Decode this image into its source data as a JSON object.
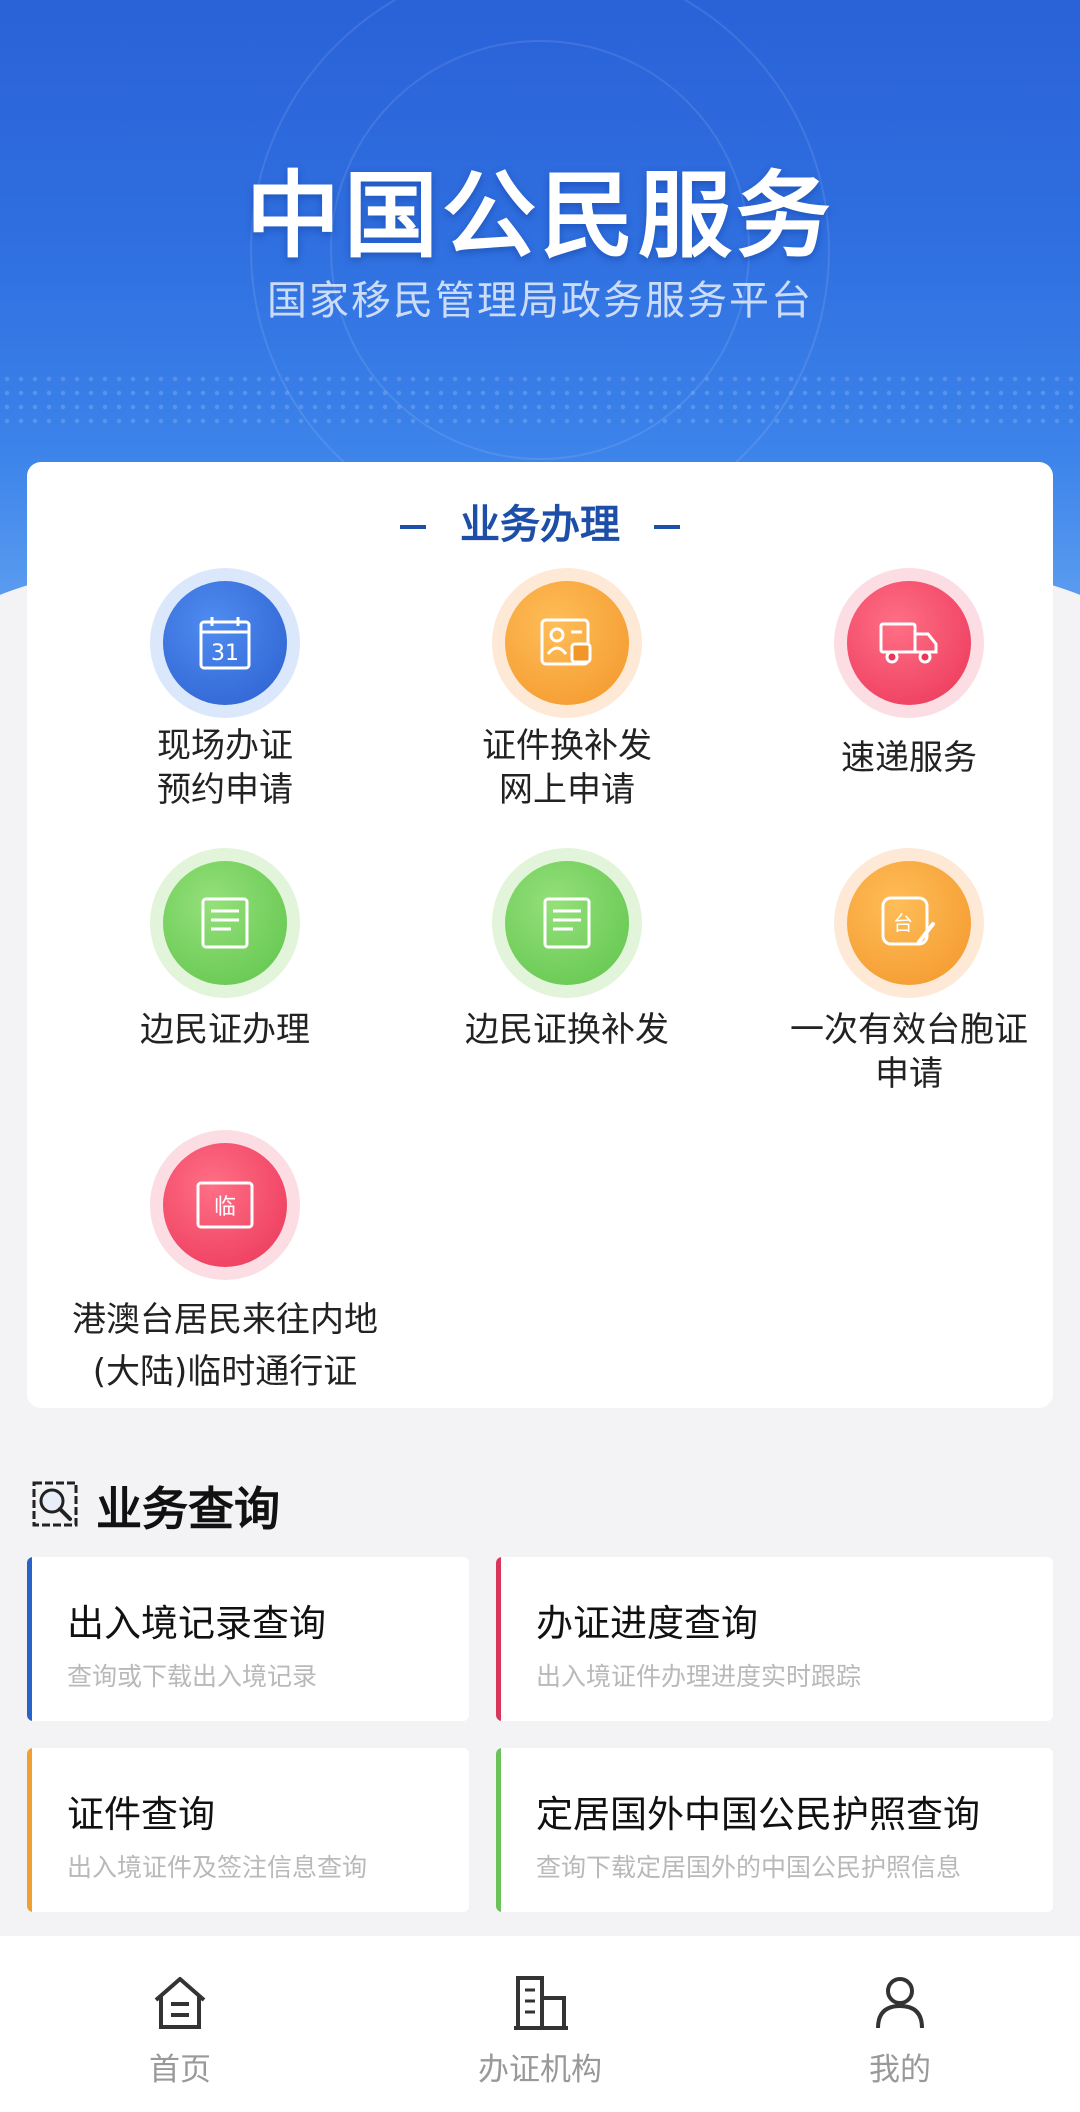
{
  "banner": {
    "title": "中国公民服务",
    "subtitle": "国家移民管理局政务服务平台"
  },
  "business": {
    "heading": "业务办理",
    "services": [
      {
        "label": "现场办证\n预约申请",
        "icon": "calendar-icon",
        "color": "#2c5fcf"
      },
      {
        "label": "证件换补发\n网上申请",
        "icon": "id-card-icon",
        "color": "#f2962a"
      },
      {
        "label": "速递服务",
        "icon": "truck-icon",
        "color": "#ea3558"
      },
      {
        "label": "边民证办理",
        "icon": "document-icon",
        "color": "#5fc44b"
      },
      {
        "label": "边民证换补发",
        "icon": "document-icon",
        "color": "#5fc44b"
      },
      {
        "label": "一次有效台胞证\n申请",
        "icon": "taiwan-pass-icon",
        "color": "#f2962a"
      },
      {
        "label": "港澳台居民来往内地\n(大陆)临时通行证",
        "icon": "temporary-pass-icon",
        "color": "#ea3558"
      }
    ],
    "calendar_glyph": "31",
    "taiwan_glyph": "台",
    "temporary_glyph": "临"
  },
  "query": {
    "title": "业务查询",
    "cards": [
      {
        "title": "出入境记录查询",
        "subtitle": "查询或下载出入境记录",
        "accent": "#2a62c8"
      },
      {
        "title": "办证进度查询",
        "subtitle": "出入境证件办理进度实时跟踪",
        "accent": "#d8365a"
      },
      {
        "title": "证件查询",
        "subtitle": "出入境证件及签注信息查询",
        "accent": "#f0a030"
      },
      {
        "title": "定居国外中国公民护照查询",
        "subtitle": "查询下载定居国外的中国公民护照信息",
        "accent": "#6cc25a"
      }
    ]
  },
  "nav": {
    "items": [
      {
        "label": "首页",
        "icon": "home-icon"
      },
      {
        "label": "办证机构",
        "icon": "building-icon"
      },
      {
        "label": "我的",
        "icon": "user-icon"
      }
    ]
  }
}
